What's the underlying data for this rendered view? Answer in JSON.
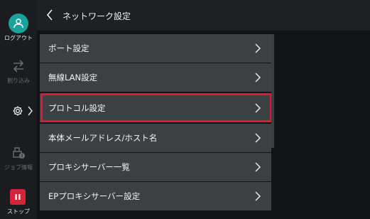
{
  "header": {
    "title": "ネットワーク設定"
  },
  "sidebar": {
    "logout_label": "ログアウト",
    "interrupt_label": "割り込み",
    "job_info_label": "ジョブ情報",
    "stop_label": "ストップ"
  },
  "menu": {
    "items": [
      {
        "label": "ポート設定"
      },
      {
        "label": "無線LAN設定"
      },
      {
        "label": "プロトコル設定"
      },
      {
        "label": "本体メールアドレス/ホスト名"
      },
      {
        "label": "プロキシサーバー一覧"
      },
      {
        "label": "EPプロキシサーバー設定"
      }
    ],
    "highlighted_index": 2
  },
  "colors": {
    "accent_teal": "#1aa39c",
    "stop_red": "#d5243a",
    "highlight_red": "#e0192f",
    "row_bg": "#3d4043"
  }
}
